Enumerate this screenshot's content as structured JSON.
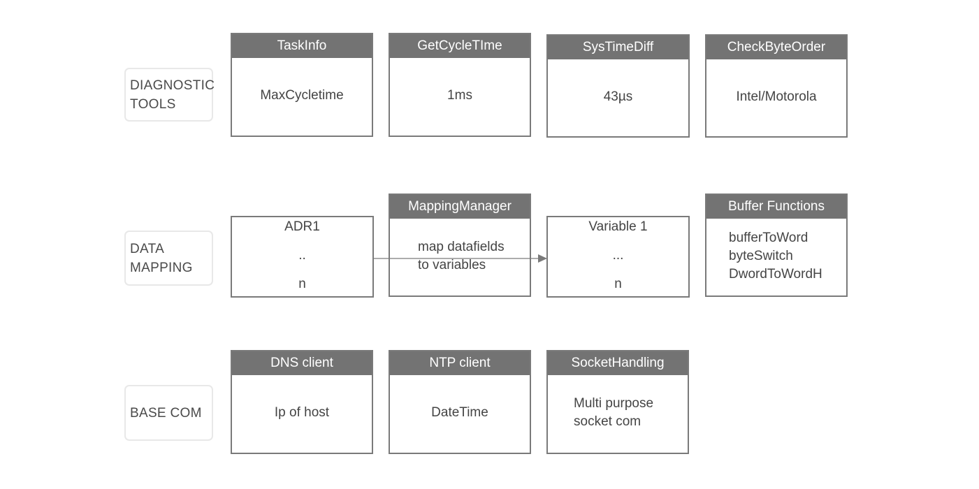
{
  "diagram": {
    "rows": [
      {
        "label": [
          "DIAGNOSTIC",
          "TOOLS"
        ],
        "blocks": [
          {
            "title": "TaskInfo",
            "lines": [
              "MaxCycletime"
            ]
          },
          {
            "title": "GetCycleTIme",
            "lines": [
              "1ms"
            ]
          },
          {
            "title": "SysTimeDiff",
            "lines": [
              "43µs"
            ]
          },
          {
            "title": "CheckByteOrder",
            "lines": [
              "Intel/Motorola"
            ]
          }
        ]
      },
      {
        "label": [
          "DATA",
          "MAPPING"
        ],
        "blocks": [
          {
            "title": "",
            "lines": [
              "ADR1",
              "..",
              "n"
            ]
          },
          {
            "title": "MappingManager",
            "lines": [
              "map datafields",
              "to variables"
            ]
          },
          {
            "title": "",
            "lines": [
              "Variable 1",
              "...",
              "n"
            ]
          },
          {
            "title": "Buffer Functions",
            "lines": [
              "bufferToWord",
              "byteSwitch",
              "DwordToWordH"
            ]
          }
        ],
        "connector": {
          "from": "ADR1 list",
          "to": "Variable list",
          "type": "arrow"
        }
      },
      {
        "label": [
          "BASE COM"
        ],
        "blocks": [
          {
            "title": "DNS client",
            "lines": [
              "Ip of host"
            ]
          },
          {
            "title": "NTP client",
            "lines": [
              "DateTime"
            ]
          },
          {
            "title": "SocketHandling",
            "lines": [
              "Multi purpose",
              "socket com"
            ]
          }
        ]
      }
    ],
    "colors": {
      "header_fill": "#737373",
      "header_text": "#ffffff",
      "box_border": "#7a7a7a",
      "label_border": "#e8e8e8",
      "text": "#444444"
    }
  }
}
